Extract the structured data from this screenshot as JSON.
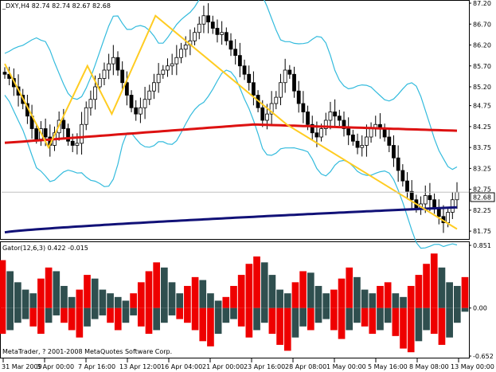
{
  "header": {
    "symbol_line": "_DXY,H4  82.74 82.74 82.67 82.68",
    "indicator_line": "Gator(12,6,3) 0.422 -0.015",
    "copyright": "MetaTrader, ? 2001-2008 MetaQuotes Software Corp."
  },
  "chart_data": [
    {
      "type": "candlestick",
      "title": "_DXY,H4",
      "ohlc_last": {
        "open": 82.74,
        "high": 82.74,
        "low": 82.67,
        "close": 82.68
      },
      "ylim": [
        81.6,
        87.2
      ],
      "y_ticks": [
        "87.20",
        "86.70",
        "86.20",
        "85.70",
        "85.20",
        "84.75",
        "84.25",
        "83.75",
        "83.25",
        "82.75",
        "82.25",
        "81.75"
      ],
      "current_price_label": "82.68",
      "current_price": 82.68,
      "x_ticks": [
        "31 Mar 2009",
        "3 Apr 00:00",
        "7 Apr 16:00",
        "13 Apr 12:00",
        "16 Apr 04:00",
        "21 Apr 00:00",
        "23 Apr 16:00",
        "28 Apr 08:00",
        "1 May 00:00",
        "5 May 16:00",
        "8 May 08:00",
        "13 May 00:00"
      ],
      "close_series": [
        85.5,
        85.4,
        85.2,
        85.0,
        84.8,
        84.5,
        84.2,
        83.95,
        84.2,
        84.0,
        83.8,
        84.1,
        84.4,
        84.2,
        83.9,
        83.8,
        83.85,
        84.3,
        84.7,
        84.9,
        85.2,
        85.4,
        85.6,
        85.75,
        85.9,
        85.6,
        85.3,
        85.0,
        84.7,
        84.55,
        84.7,
        84.9,
        85.1,
        85.3,
        85.5,
        85.6,
        85.7,
        85.75,
        85.9,
        86.1,
        86.2,
        86.3,
        86.5,
        86.7,
        86.9,
        86.75,
        86.6,
        86.45,
        86.5,
        86.3,
        86.1,
        85.95,
        85.7,
        85.5,
        85.3,
        85.0,
        84.7,
        84.4,
        84.55,
        84.8,
        84.95,
        85.3,
        85.6,
        85.5,
        85.1,
        84.8,
        84.6,
        84.3,
        84.1,
        84.0,
        84.2,
        84.4,
        84.6,
        84.5,
        84.4,
        84.2,
        84.05,
        83.9,
        83.75,
        83.8,
        84.0,
        84.2,
        84.3,
        84.2,
        84.0,
        83.8,
        83.5,
        83.2,
        82.95,
        82.7,
        82.5,
        82.3,
        82.4,
        82.6,
        82.5,
        82.3,
        82.1,
        81.95,
        82.2,
        82.5,
        82.68
      ],
      "bollinger_band_color": "#33bbdd",
      "zigzag_color": "#ffcc22",
      "zigzag_points": [
        [
          0,
          85.75
        ],
        [
          9,
          83.75
        ],
        [
          17,
          85.7
        ],
        [
          22,
          84.55
        ],
        [
          31,
          86.9
        ],
        [
          58,
          84.3
        ],
        [
          93,
          81.8
        ]
      ],
      "ma_slow_color": "#dd1111",
      "ma_slow": {
        "start": 83.86,
        "peak": 84.3,
        "end": 84.15
      },
      "ma_slower_color": "#111177",
      "ma_slower": {
        "start": 81.72,
        "end": 82.32
      },
      "candle_color": "#000000"
    },
    {
      "type": "bar",
      "title": "Gator(12,6,3)",
      "values_last": [
        0.422,
        -0.015
      ],
      "ylim": [
        -0.652,
        0.851
      ],
      "y_ticks": [
        "0.851",
        "0.00",
        "-0.652"
      ],
      "series": [
        {
          "name": "upper",
          "color_up": "#ee0000",
          "color_down": "#2f4f4f",
          "values": [
            0.65,
            0.5,
            0.35,
            0.25,
            0.2,
            0.4,
            0.55,
            0.5,
            0.3,
            0.15,
            0.25,
            0.45,
            0.4,
            0.25,
            0.2,
            0.15,
            0.1,
            0.2,
            0.35,
            0.5,
            0.62,
            0.55,
            0.35,
            0.2,
            0.3,
            0.42,
            0.38,
            0.2,
            0.1,
            0.15,
            0.3,
            0.45,
            0.6,
            0.7,
            0.62,
            0.45,
            0.25,
            0.2,
            0.35,
            0.5,
            0.48,
            0.3,
            0.2,
            0.25,
            0.4,
            0.55,
            0.42,
            0.25,
            0.2,
            0.3,
            0.35,
            0.2,
            0.15,
            0.3,
            0.45,
            0.6,
            0.74,
            0.55,
            0.35,
            0.3,
            0.42
          ]
        },
        {
          "name": "lower",
          "color_up": "#2f4f4f",
          "color_down": "#ee0000",
          "values": [
            -0.35,
            -0.3,
            -0.2,
            -0.15,
            -0.25,
            -0.35,
            -0.2,
            -0.1,
            -0.2,
            -0.3,
            -0.4,
            -0.25,
            -0.15,
            -0.1,
            -0.2,
            -0.3,
            -0.2,
            -0.1,
            -0.25,
            -0.35,
            -0.3,
            -0.2,
            -0.1,
            -0.15,
            -0.2,
            -0.3,
            -0.45,
            -0.52,
            -0.35,
            -0.2,
            -0.15,
            -0.25,
            -0.4,
            -0.3,
            -0.2,
            -0.35,
            -0.5,
            -0.58,
            -0.4,
            -0.25,
            -0.3,
            -0.2,
            -0.15,
            -0.3,
            -0.42,
            -0.3,
            -0.2,
            -0.25,
            -0.35,
            -0.3,
            -0.2,
            -0.38,
            -0.55,
            -0.6,
            -0.45,
            -0.3,
            -0.35,
            -0.5,
            -0.4,
            -0.2,
            -0.05
          ]
        }
      ]
    }
  ]
}
